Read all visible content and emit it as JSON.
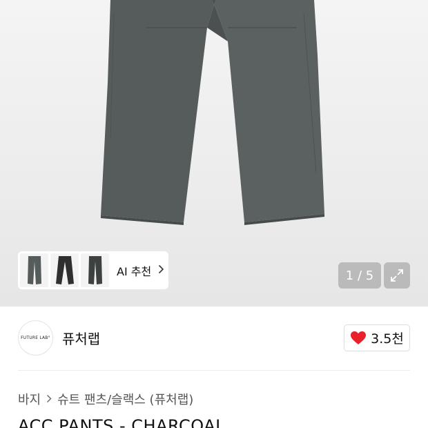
{
  "gallery": {
    "ai_recommend_label": "AI 추천",
    "counter_text": "1 / 5",
    "thumbnails": [
      {
        "name": "thumb-charcoal-1"
      },
      {
        "name": "thumb-black"
      },
      {
        "name": "thumb-charcoal-2"
      }
    ]
  },
  "brand": {
    "logo_text": "FUTURE LAB°",
    "name": "퓨처랩"
  },
  "like": {
    "count": "3.5천",
    "icon": "heart-icon",
    "color": "#e8212b"
  },
  "breadcrumb": {
    "category": "바지",
    "subcategory": "슈트 팬츠/슬랙스 (퓨처랩)"
  },
  "product": {
    "title": "ACC PANTS - CHARCOAL"
  },
  "colors": {
    "pants": "#555c5b",
    "pants_dark": "#3f4544",
    "hero_bg": "#ececec"
  }
}
